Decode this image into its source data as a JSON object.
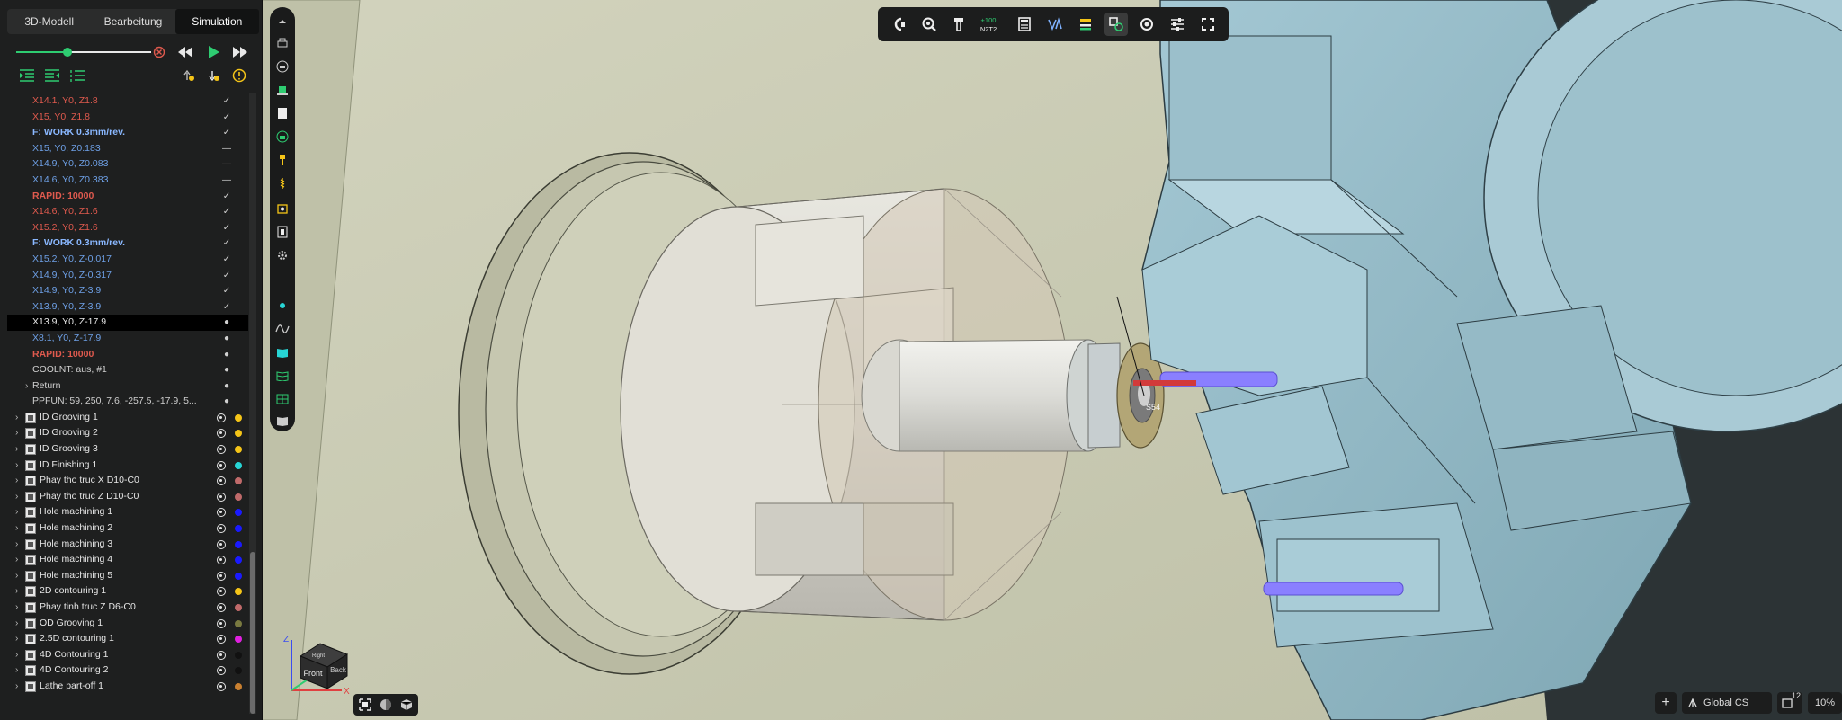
{
  "tabs": [
    {
      "label": "3D-Modell",
      "active": false
    },
    {
      "label": "Bearbeitung",
      "active": false
    },
    {
      "label": "Simulation",
      "active": true
    }
  ],
  "simulation": {
    "progress": 0.38
  },
  "colors": {
    "rapid": "#e05a4e",
    "feed": "#7fb2ff",
    "feedbold": "#8ab8ff",
    "cutting": "#6ea0e6",
    "plain": "#cfcfcf",
    "selected": "#e6e6e6"
  },
  "tree_steps": [
    {
      "text": "X14.1, Y0, Z1.8",
      "kind": "rapid",
      "mark": "✓"
    },
    {
      "text": "X15, Y0, Z1.8",
      "kind": "rapid",
      "mark": "✓"
    },
    {
      "text": "F: WORK 0.3mm/rev.",
      "kind": "feedbold",
      "mark": "✓"
    },
    {
      "text": "X15, Y0, Z0.183",
      "kind": "cutting",
      "mark": "—"
    },
    {
      "text": "X14.9, Y0, Z0.083",
      "kind": "cutting",
      "mark": "—"
    },
    {
      "text": "X14.6, Y0, Z0.383",
      "kind": "cutting",
      "mark": "—"
    },
    {
      "text": "RAPID: 10000",
      "kind": "rapidbold",
      "mark": "✓"
    },
    {
      "text": "X14.6, Y0, Z1.6",
      "kind": "rapid",
      "mark": "✓"
    },
    {
      "text": "X15.2, Y0, Z1.6",
      "kind": "rapid",
      "mark": "✓"
    },
    {
      "text": "F: WORK 0.3mm/rev.",
      "kind": "feedbold",
      "mark": "✓"
    },
    {
      "text": "X15.2, Y0, Z-0.017",
      "kind": "cutting",
      "mark": "✓"
    },
    {
      "text": "X14.9, Y0, Z-0.317",
      "kind": "cutting",
      "mark": "✓"
    },
    {
      "text": "X14.9, Y0, Z-3.9",
      "kind": "cutting",
      "mark": "✓"
    },
    {
      "text": "X13.9, Y0, Z-3.9",
      "kind": "cutting",
      "mark": "✓"
    },
    {
      "text": "X13.9, Y0, Z-17.9",
      "kind": "selected",
      "mark": "●"
    },
    {
      "text": "X8.1, Y0, Z-17.9",
      "kind": "cutting",
      "mark": "●"
    },
    {
      "text": "RAPID: 10000",
      "kind": "rapidbold",
      "mark": "●"
    },
    {
      "text": "COOLNT: aus, #1",
      "kind": "plain",
      "mark": "●"
    },
    {
      "text": "Return",
      "kind": "plain",
      "mark": "●",
      "expand": true
    },
    {
      "text": "PPFUN: 59, 250, 7.6, -257.5, -17.9, 5...",
      "kind": "plain",
      "mark": "●"
    }
  ],
  "operations": [
    {
      "label": "ID Grooving 1",
      "dot": "#f5c518",
      "icon": "grooving-icon"
    },
    {
      "label": "ID Grooving 2",
      "dot": "#f5c518",
      "icon": "grooving-icon"
    },
    {
      "label": "ID Grooving 3",
      "dot": "#f5c518",
      "icon": "grooving-icon"
    },
    {
      "label": "ID Finishing 1",
      "dot": "#27d5d5",
      "icon": "finishing-icon"
    },
    {
      "label": "Phay tho truc X D10-C0",
      "dot": "#c06a6a",
      "icon": "milling-icon"
    },
    {
      "label": "Phay tho truc Z D10-C0",
      "dot": "#c06a6a",
      "icon": "milling-icon"
    },
    {
      "label": "Hole machining 1",
      "dot": "#1a1aff",
      "icon": "drilling-icon"
    },
    {
      "label": "Hole machining 2",
      "dot": "#1a1aff",
      "icon": "drilling-icon"
    },
    {
      "label": "Hole machining 3",
      "dot": "#1a1aff",
      "icon": "drilling-icon"
    },
    {
      "label": "Hole machining 4",
      "dot": "#1a1aff",
      "icon": "drilling-icon"
    },
    {
      "label": "Hole machining 5",
      "dot": "#1a1aff",
      "icon": "drilling-icon"
    },
    {
      "label": "2D contouring 1",
      "dot": "#f5c518",
      "icon": "contouring-icon"
    },
    {
      "label": "Phay tinh truc Z D6-C0",
      "dot": "#c06a6a",
      "icon": "milling-icon"
    },
    {
      "label": "OD Grooving 1",
      "dot": "#7a7a40",
      "icon": "grooving-icon"
    },
    {
      "label": "2.5D contouring 1",
      "dot": "#e020e0",
      "icon": "contouring-icon"
    },
    {
      "label": "4D Contouring 1",
      "dot": "#111111",
      "icon": "contouring-icon"
    },
    {
      "label": "4D Contouring 2",
      "dot": "#111111",
      "icon": "contouring-icon"
    },
    {
      "label": "Lathe part-off 1",
      "dot": "#c98030",
      "icon": "partoff-icon"
    }
  ],
  "toolbar_top": {
    "counter_top": "+100",
    "counter_bottom": "N2T2"
  },
  "viewport": {
    "tool_label": "S54"
  },
  "view_cube": {
    "front": "Front",
    "back": "Back",
    "top": "Right",
    "axis_z": "Z",
    "axis_x": "X"
  },
  "status": {
    "coordinate_system": "Global CS",
    "extra_count": "12",
    "zoom": "10%"
  }
}
